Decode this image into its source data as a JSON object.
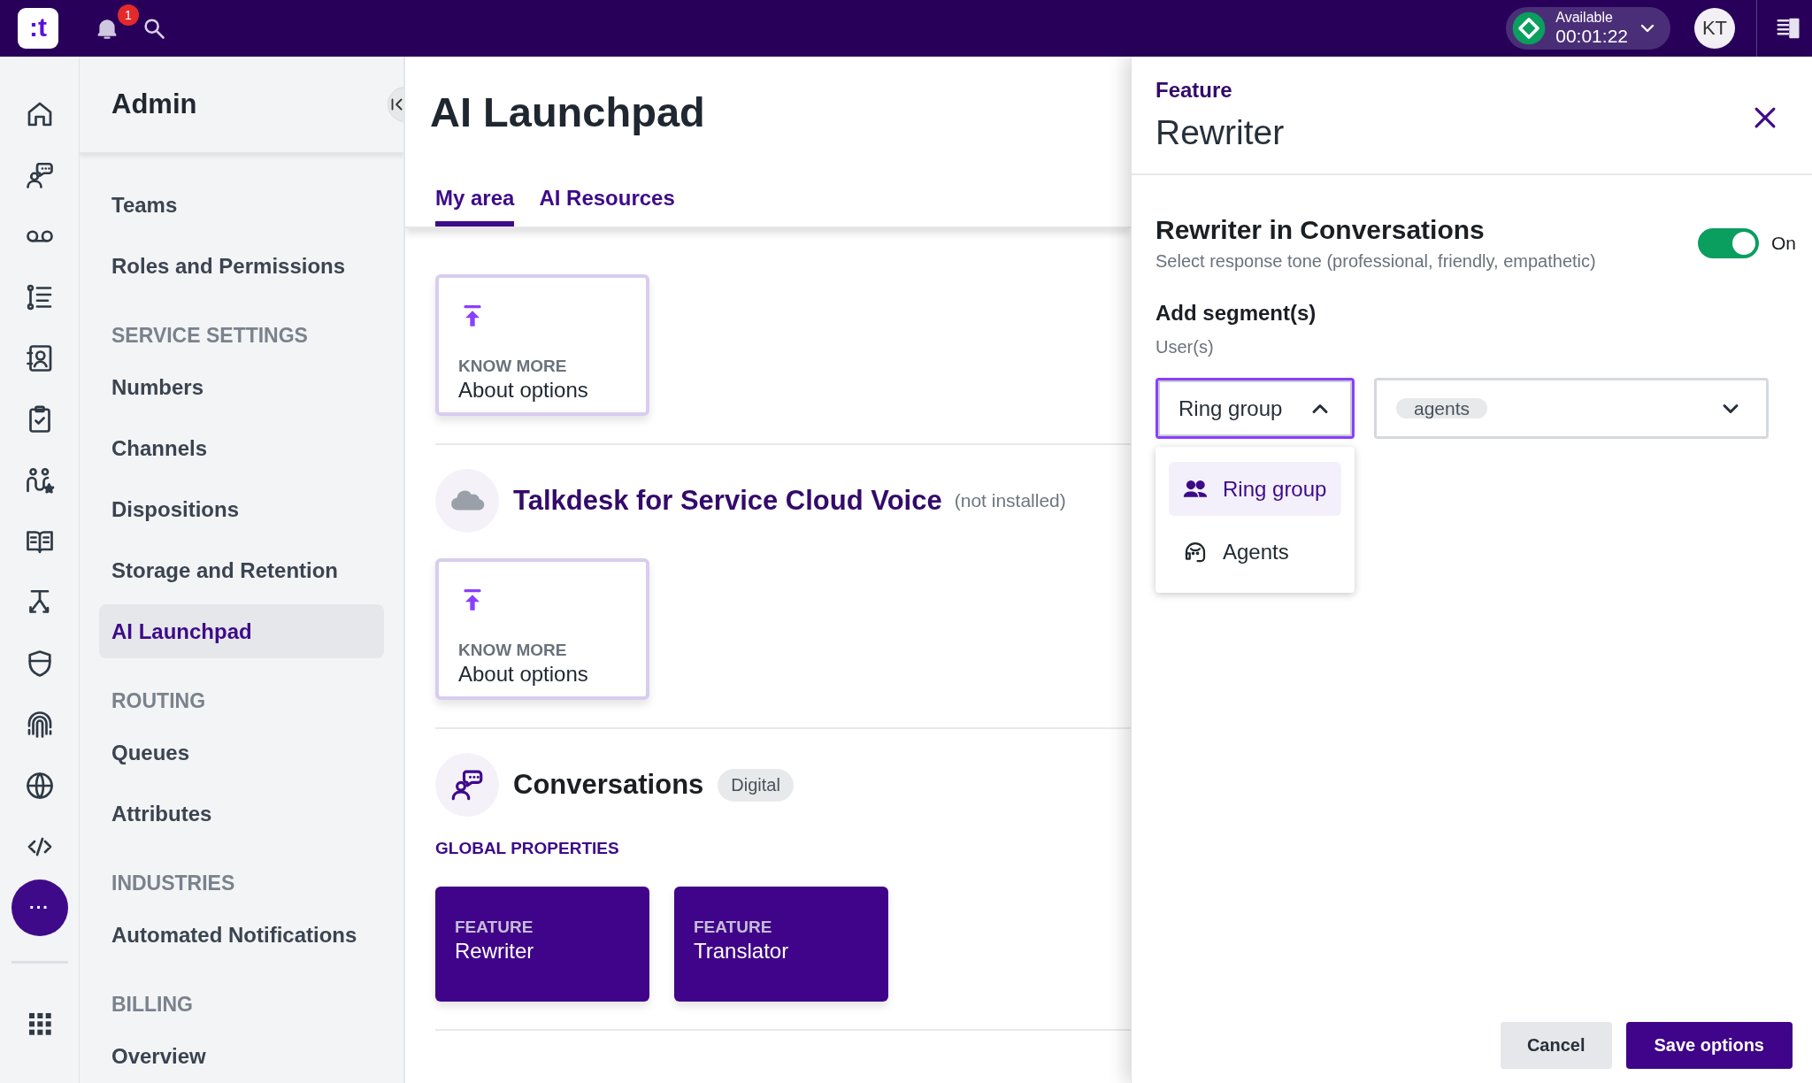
{
  "top_bar": {
    "logo": ":t",
    "notification_count": "1",
    "status": {
      "label": "Available",
      "timer": "00:01:22"
    },
    "avatar": "KT"
  },
  "rail": {
    "more_label": "···"
  },
  "sidebar": {
    "title": "Admin",
    "items": [
      {
        "kind": "item",
        "label": "Teams",
        "selected": false
      },
      {
        "kind": "item",
        "label": "Roles and Permissions",
        "selected": false
      },
      {
        "kind": "heading",
        "label": "SERVICE SETTINGS"
      },
      {
        "kind": "item",
        "label": "Numbers",
        "selected": false
      },
      {
        "kind": "item",
        "label": "Channels",
        "selected": false
      },
      {
        "kind": "item",
        "label": "Dispositions",
        "selected": false
      },
      {
        "kind": "item",
        "label": "Storage and Retention",
        "selected": false
      },
      {
        "kind": "item",
        "label": "AI Launchpad",
        "selected": true
      },
      {
        "kind": "heading",
        "label": "ROUTING"
      },
      {
        "kind": "item",
        "label": "Queues",
        "selected": false
      },
      {
        "kind": "item",
        "label": "Attributes",
        "selected": false
      },
      {
        "kind": "heading",
        "label": "INDUSTRIES"
      },
      {
        "kind": "item",
        "label": "Automated Notifications",
        "selected": false
      },
      {
        "kind": "heading",
        "label": "BILLING"
      },
      {
        "kind": "item",
        "label": "Overview",
        "selected": false
      }
    ]
  },
  "main": {
    "title": "AI Launchpad",
    "tabs": [
      {
        "label": "My area",
        "selected": true
      },
      {
        "label": "AI Resources",
        "selected": false
      }
    ],
    "sections": [
      {
        "kind": "cards-only",
        "cards": [
          {
            "kind": "know-more",
            "eyebrow": "KNOW MORE",
            "title": "About options"
          }
        ]
      },
      {
        "kind": "integration",
        "title": "Talkdesk for Service Cloud Voice",
        "note": "(not installed)",
        "cards": [
          {
            "kind": "know-more",
            "eyebrow": "KNOW MORE",
            "title": "About options"
          }
        ]
      },
      {
        "kind": "product",
        "title": "Conversations",
        "tag": "Digital",
        "subheading": "GLOBAL PROPERTIES",
        "cards": [
          {
            "kind": "feature",
            "eyebrow": "FEATURE",
            "title": "Rewriter"
          },
          {
            "kind": "feature",
            "eyebrow": "FEATURE",
            "title": "Translator"
          }
        ]
      }
    ]
  },
  "panel": {
    "eyebrow": "Feature",
    "title": "Rewriter",
    "setting": {
      "title": "Rewriter in Conversations",
      "description": "Select response tone (professional, friendly, empathetic)",
      "on": true,
      "state_label": "On"
    },
    "segments": {
      "heading": "Add segment(s)",
      "label": "User(s)",
      "type_select": {
        "value": "Ring group",
        "expanded": true,
        "options": [
          {
            "label": "Ring group",
            "selected": true
          },
          {
            "label": "Agents",
            "selected": false
          }
        ]
      },
      "values_select": {
        "chips": [
          "agents"
        ]
      }
    },
    "buttons": [
      {
        "kind": "secondary",
        "label": "Cancel"
      },
      {
        "kind": "primary",
        "label": "Save options"
      }
    ]
  }
}
